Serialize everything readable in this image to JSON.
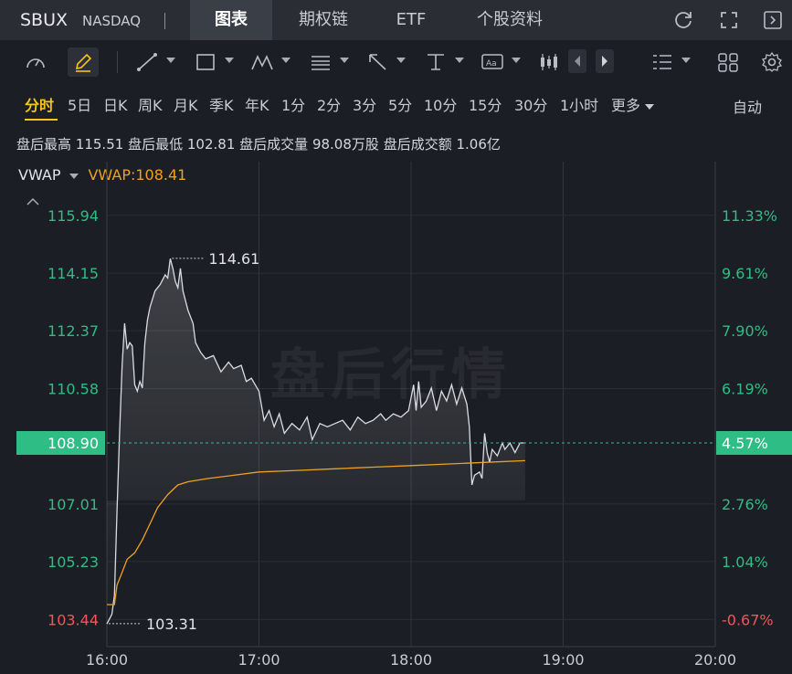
{
  "header": {
    "ticker": "SBUX",
    "exchange": "NASDAQ",
    "separator": "|",
    "tabs": [
      {
        "label": "图表",
        "active": true
      },
      {
        "label": "期权链",
        "active": false
      },
      {
        "label": "ETF",
        "active": false
      },
      {
        "label": "个股资料",
        "active": false
      }
    ],
    "icons": [
      "refresh-icon",
      "expand-icon",
      "collapse-panel-icon"
    ]
  },
  "toolbar": {
    "tools": [
      "indicator-gauge-icon",
      "draw-pen-icon",
      "trend-line-icon",
      "rectangle-icon",
      "pattern-icon",
      "fibonacci-icon",
      "arrow-icon",
      "measure-icon",
      "text-annotation-icon",
      "candlestick-icon",
      "prev-arrow-icon",
      "next-arrow-icon",
      "layout-list-icon",
      "grid-icon",
      "settings-icon"
    ]
  },
  "periods": {
    "items": [
      "分时",
      "5日",
      "日K",
      "周K",
      "月K",
      "季K",
      "年K",
      "1分",
      "2分",
      "3分",
      "5分",
      "10分",
      "15分",
      "30分",
      "1小时",
      "更多"
    ],
    "active_index": 0,
    "auto_label": "自动"
  },
  "info": {
    "high_label": "盘后最高",
    "high_value": "115.51",
    "low_label": "盘后最低",
    "low_value": "102.81",
    "volume_label": "盘后成交量",
    "volume_value": "98.08万股",
    "amount_label": "盘后成交额",
    "amount_value": "1.06亿"
  },
  "vwap": {
    "name": "VWAP",
    "value_text": "VWAP:108.41"
  },
  "watermark": "盘后行情",
  "colors": {
    "up": "#2ebd85",
    "down": "#f0565a",
    "price_line": "#d9dce1",
    "vwap_line": "#f0a020",
    "current_badge": "#2ebd85",
    "background": "#1b1e24",
    "accent": "#f5c518"
  },
  "chart_data": {
    "type": "line",
    "x_ticks": [
      "16:00",
      "17:00",
      "18:00",
      "19:00",
      "20:00"
    ],
    "y_ticks_left": [
      "115.94",
      "114.15",
      "112.37",
      "110.58",
      "108.90",
      "107.01",
      "105.23",
      "103.44"
    ],
    "y_ticks_right": [
      "11.33%",
      "9.61%",
      "7.90%",
      "6.19%",
      "4.57%",
      "2.76%",
      "1.04%",
      "-0.67%"
    ],
    "y_tick_values": [
      115.94,
      114.15,
      112.37,
      110.58,
      108.9,
      107.01,
      105.23,
      103.44
    ],
    "ylim": [
      102.6,
      117.6
    ],
    "current_price": 108.9,
    "current_pct": "4.57%",
    "high_marker": {
      "time": "16:25",
      "value": 114.61,
      "label": "114.61"
    },
    "low_marker": {
      "time": "16:00",
      "value": 103.31,
      "label": "103.31"
    },
    "series": [
      {
        "name": "price",
        "points": [
          [
            "16:00",
            103.3
          ],
          [
            "16:02",
            103.6
          ],
          [
            "16:03",
            104.2
          ],
          [
            "16:04",
            106.8
          ],
          [
            "16:05",
            109.2
          ],
          [
            "16:06",
            111.3
          ],
          [
            "16:07",
            112.6
          ],
          [
            "16:08",
            111.8
          ],
          [
            "16:09",
            112.0
          ],
          [
            "16:10",
            111.9
          ],
          [
            "16:11",
            110.7
          ],
          [
            "16:12",
            110.5
          ],
          [
            "16:13",
            110.8
          ],
          [
            "16:14",
            110.6
          ],
          [
            "16:15",
            112.0
          ],
          [
            "16:16",
            112.7
          ],
          [
            "16:17",
            113.1
          ],
          [
            "16:19",
            113.6
          ],
          [
            "16:21",
            113.8
          ],
          [
            "16:23",
            114.1
          ],
          [
            "16:24",
            114.0
          ],
          [
            "16:25",
            114.6
          ],
          [
            "16:26",
            114.3
          ],
          [
            "16:27",
            113.9
          ],
          [
            "16:28",
            113.7
          ],
          [
            "16:29",
            114.3
          ],
          [
            "16:30",
            113.6
          ],
          [
            "16:32",
            113.0
          ],
          [
            "16:34",
            112.6
          ],
          [
            "16:35",
            112.0
          ],
          [
            "16:37",
            111.7
          ],
          [
            "16:39",
            111.5
          ],
          [
            "16:42",
            111.6
          ],
          [
            "16:45",
            111.1
          ],
          [
            "16:48",
            111.4
          ],
          [
            "16:50",
            111.2
          ],
          [
            "16:53",
            111.3
          ],
          [
            "16:55",
            110.8
          ],
          [
            "16:57",
            110.9
          ],
          [
            "17:00",
            110.5
          ],
          [
            "17:02",
            109.6
          ],
          [
            "17:04",
            109.9
          ],
          [
            "17:06",
            109.4
          ],
          [
            "17:08",
            109.8
          ],
          [
            "17:10",
            109.2
          ],
          [
            "17:13",
            109.5
          ],
          [
            "17:16",
            109.3
          ],
          [
            "17:19",
            109.7
          ],
          [
            "17:21",
            109.0
          ],
          [
            "17:24",
            109.5
          ],
          [
            "17:27",
            109.4
          ],
          [
            "17:30",
            109.5
          ],
          [
            "17:33",
            109.6
          ],
          [
            "17:36",
            109.3
          ],
          [
            "17:39",
            109.7
          ],
          [
            "17:42",
            109.5
          ],
          [
            "17:45",
            109.6
          ],
          [
            "17:48",
            109.8
          ],
          [
            "17:50",
            109.6
          ],
          [
            "17:53",
            109.8
          ],
          [
            "17:56",
            109.7
          ],
          [
            "17:59",
            109.9
          ],
          [
            "18:01",
            110.7
          ],
          [
            "18:02",
            109.9
          ],
          [
            "18:03",
            110.8
          ],
          [
            "18:04",
            110.0
          ],
          [
            "18:06",
            110.2
          ],
          [
            "18:08",
            110.6
          ],
          [
            "18:10",
            109.9
          ],
          [
            "18:12",
            110.5
          ],
          [
            "18:14",
            110.2
          ],
          [
            "18:16",
            110.7
          ],
          [
            "18:18",
            110.1
          ],
          [
            "18:20",
            110.6
          ],
          [
            "18:22",
            110.1
          ],
          [
            "18:23",
            109.4
          ],
          [
            "18:24",
            107.6
          ],
          [
            "18:25",
            107.9
          ],
          [
            "18:27",
            108.0
          ],
          [
            "18:28",
            107.8
          ],
          [
            "18:29",
            109.2
          ],
          [
            "18:30",
            108.6
          ],
          [
            "18:31",
            108.3
          ],
          [
            "18:32",
            108.7
          ],
          [
            "18:34",
            108.5
          ],
          [
            "18:36",
            108.9
          ],
          [
            "18:37",
            108.7
          ],
          [
            "18:39",
            108.9
          ],
          [
            "18:41",
            108.6
          ],
          [
            "18:43",
            108.9
          ],
          [
            "18:45",
            108.9
          ]
        ]
      },
      {
        "name": "VWAP",
        "points": [
          [
            "16:00",
            103.9
          ],
          [
            "16:03",
            103.9
          ],
          [
            "16:04",
            104.5
          ],
          [
            "16:06",
            104.9
          ],
          [
            "16:08",
            105.3
          ],
          [
            "16:11",
            105.5
          ],
          [
            "16:14",
            105.9
          ],
          [
            "16:17",
            106.4
          ],
          [
            "16:20",
            106.9
          ],
          [
            "16:24",
            107.3
          ],
          [
            "16:28",
            107.6
          ],
          [
            "16:32",
            107.7
          ],
          [
            "16:40",
            107.8
          ],
          [
            "16:50",
            107.9
          ],
          [
            "17:00",
            108.0
          ],
          [
            "17:15",
            108.05
          ],
          [
            "17:30",
            108.1
          ],
          [
            "17:45",
            108.15
          ],
          [
            "18:00",
            108.2
          ],
          [
            "18:15",
            108.25
          ],
          [
            "18:30",
            108.3
          ],
          [
            "18:45",
            108.35
          ]
        ]
      }
    ]
  }
}
